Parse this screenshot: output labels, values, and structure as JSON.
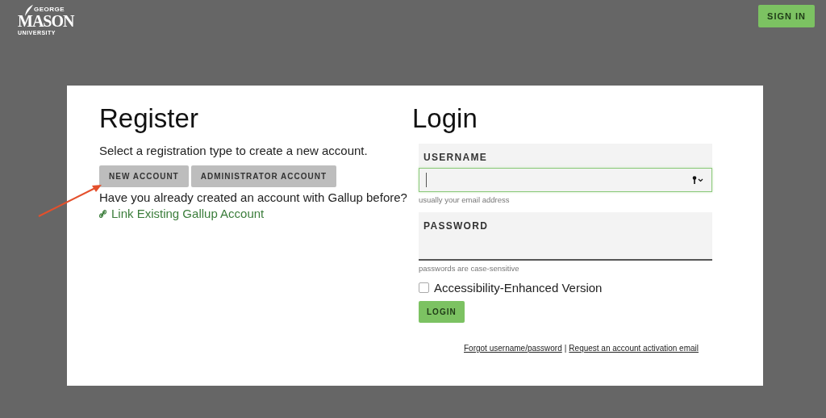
{
  "header": {
    "logo": {
      "top": "GEORGE",
      "main": "MASON",
      "bottom": "UNIVERSITY"
    },
    "sign_in_button": "SIGN IN"
  },
  "register": {
    "title": "Register",
    "instructions": "Select a registration type to create a new account.",
    "buttons": [
      {
        "label": "NEW ACCOUNT"
      },
      {
        "label": "ADMINISTRATOR ACCOUNT"
      }
    ],
    "question": "Have you already created an account with Gallup before?",
    "link": "Link Existing Gallup Account"
  },
  "login": {
    "title": "Login",
    "fields": [
      {
        "label": "USERNAME",
        "hint": "usually your email address",
        "focused": true
      },
      {
        "label": "PASSWORD",
        "hint": "passwords are case-sensitive",
        "focused": false
      }
    ],
    "accessibility": {
      "label": "Accessibility-Enhanced Version",
      "checked": false
    },
    "login_button": "LOGIN",
    "links": [
      "Forgot username/password",
      "Request an account activation email"
    ],
    "separator": "|"
  }
}
